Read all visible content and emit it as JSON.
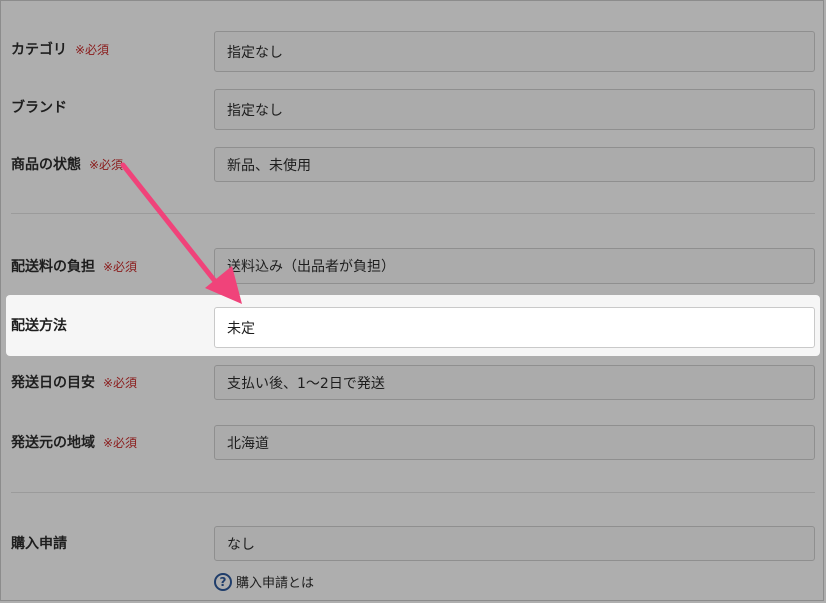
{
  "form": {
    "category": {
      "label": "カテゴリ",
      "required": "※必須",
      "value": "指定なし"
    },
    "brand": {
      "label": "ブランド",
      "value": "指定なし"
    },
    "condition": {
      "label": "商品の状態",
      "required": "※必須",
      "value": "新品、未使用"
    },
    "shipping_fee": {
      "label": "配送料の負担",
      "required": "※必須",
      "value": "送料込み（出品者が負担）"
    },
    "shipping_method": {
      "label": "配送方法",
      "value": "未定"
    },
    "ship_days": {
      "label": "発送日の目安",
      "required": "※必須",
      "value": "支払い後、1〜2日で発送"
    },
    "ship_from": {
      "label": "発送元の地域",
      "required": "※必須",
      "value": "北海道"
    },
    "purchase_request": {
      "label": "購入申請",
      "value": "なし",
      "help_text": "購入申請とは",
      "help_icon": "?"
    }
  },
  "colors": {
    "arrow": "#f0437a",
    "required": "#8a1b1b",
    "overlay": "#aeaeae"
  }
}
